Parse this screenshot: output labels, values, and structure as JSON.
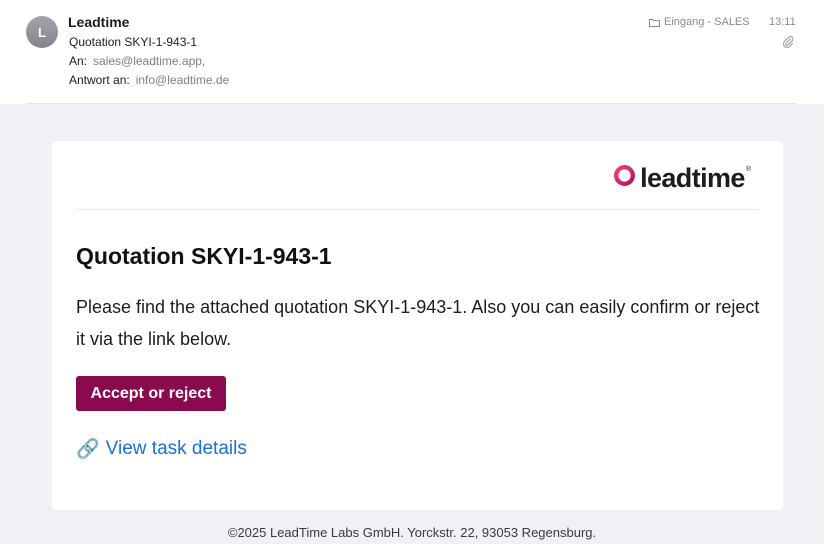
{
  "header": {
    "avatar_initial": "L",
    "sender": "Leadtime",
    "subject": "Quotation SKYI-1-943-1",
    "to_label": "An:",
    "to_value": "sales@leadtime.app,",
    "reply_to_label": "Antwort an:",
    "reply_to_value": "info@leadtime.de",
    "mailbox": "Eingang - SALES",
    "time": "13:11"
  },
  "email": {
    "logo_text": "leadtime",
    "logo_mark": "®",
    "title": "Quotation SKYI-1-943-1",
    "body": "Please find the attached quotation SKYI-1-943-1. Also you can easily confirm or reject it via the link below.",
    "cta_label": "Accept or reject",
    "task_link_icon": "🔗",
    "task_link_label": "View task details",
    "footer": "©2025 LeadTime Labs GmbH. Yorckstr. 22, 93053 Regensburg."
  },
  "colors": {
    "brand_button": "#8a0a4f",
    "link": "#1a6fd8",
    "logo_ring_gradient": [
      "#f0427a",
      "#b0166a"
    ]
  },
  "icons": {
    "avatar": "avatar-letter",
    "mailbox": "folder-icon",
    "attachment": "paperclip-icon",
    "logo": "ring-logo-icon",
    "link": "link-icon"
  }
}
